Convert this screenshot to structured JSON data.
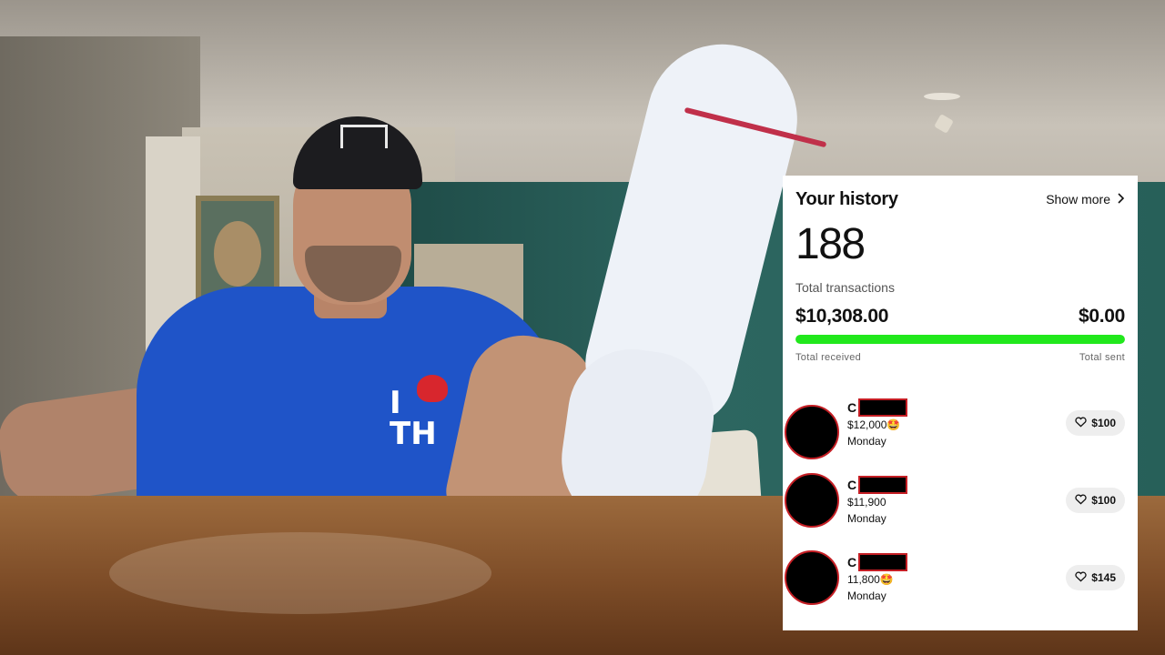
{
  "history": {
    "title": "Your history",
    "show_more_label": "Show more",
    "show_more_icon": "chevron-right-icon",
    "total_count": "188",
    "total_count_label": "Total transactions",
    "total_received": "$10,308.00",
    "total_sent": "$0.00",
    "received_label": "Total received",
    "sent_label": "Total sent",
    "received_fraction": 1.0,
    "bar_color": "#21e81c"
  },
  "transactions": [
    {
      "initial": "C",
      "note": "$12,000🤩",
      "day": "Monday",
      "like_amount": "$100"
    },
    {
      "initial": "C",
      "note": "$11,900",
      "day": "Monday",
      "like_amount": "$100"
    },
    {
      "initial": "C",
      "note": "11,800🤩",
      "day": "Monday",
      "like_amount": "$145"
    }
  ],
  "colors": {
    "redaction_border": "#c41e24",
    "redaction_fill": "#000000",
    "card_background": "#ffffff"
  },
  "scene": {
    "shirt_text": "I TH"
  }
}
